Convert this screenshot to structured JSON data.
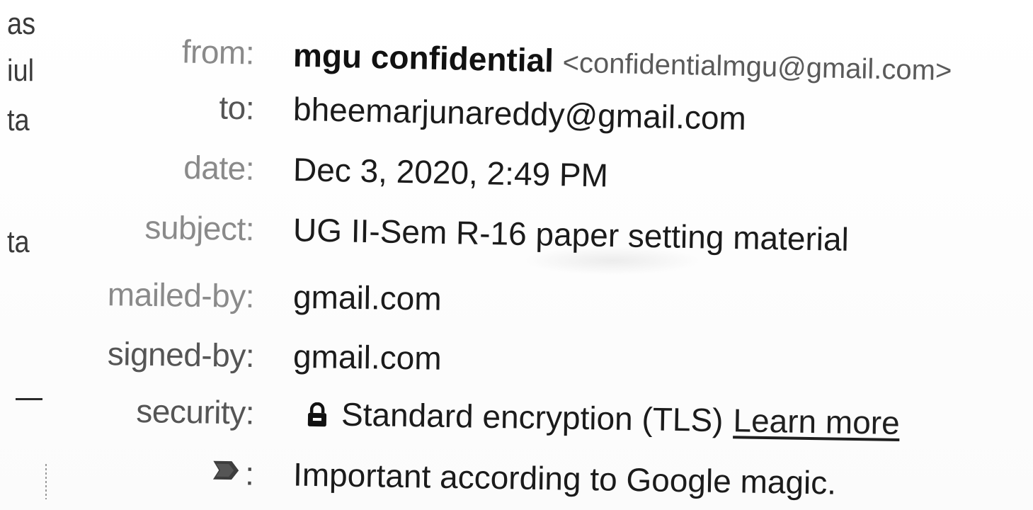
{
  "left_edge": {
    "fragments": [
      {
        "text": "as"
      },
      {
        "text": "iul"
      },
      {
        "text": "ta"
      },
      {
        "text": "ta"
      }
    ]
  },
  "header_details": {
    "from": {
      "label": "from:",
      "sender_name": "mgu confidential",
      "sender_address": "<confidentialmgu@gmail.com>"
    },
    "to": {
      "label": "to:",
      "value": "bheemarjunareddy@gmail.com"
    },
    "date": {
      "label": "date:",
      "value": "Dec 3, 2020, 2:49 PM"
    },
    "subject": {
      "label": "subject:",
      "value": "UG II-Sem R-16 paper setting material"
    },
    "mailed_by": {
      "label": "mailed-by:",
      "value": "gmail.com"
    },
    "signed_by": {
      "label": "signed-by:",
      "value": "gmail.com"
    },
    "security": {
      "label": "security:",
      "icon": "lock-icon",
      "value": "Standard encryption (TLS)",
      "link_label": "Learn more"
    },
    "importance": {
      "icon": "important-marker-icon",
      "label": ":",
      "value": "Important according to Google magic."
    }
  },
  "colors": {
    "text": "#1b1b1b",
    "label": "#4a4a4a",
    "faint_label": "#8a8a8a"
  }
}
